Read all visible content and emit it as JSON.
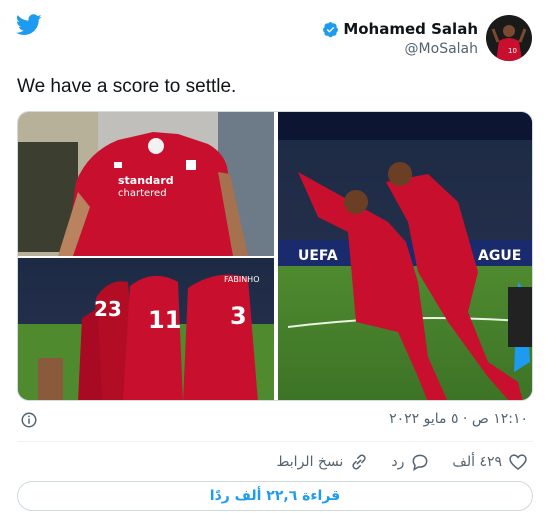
{
  "author": {
    "name": "Mohamed Salah",
    "handle": "@MoSalah"
  },
  "tweet": {
    "text": "We have a score to settle.",
    "timestamp": "١٢:١٠ ص · ٥ مايو ٢٠٢٢"
  },
  "photos": {
    "shirt_sponsor": "Standard Chartered",
    "shirt_number_1": "11",
    "shirt_number_2": "3",
    "shirt_number_3": "23",
    "shirt_name_1": "FABINHO",
    "board_text": "UEFA"
  },
  "actions": {
    "likes": "٤٢٩ ألف",
    "reply": "رد",
    "copy_link": "نسخ الرابط"
  },
  "reply_button": {
    "label": "قراءة ٢٢,٦ ألف ردًا"
  },
  "colors": {
    "twitter_blue": "#1d9bf0",
    "liverpool_red": "#c8102e"
  }
}
